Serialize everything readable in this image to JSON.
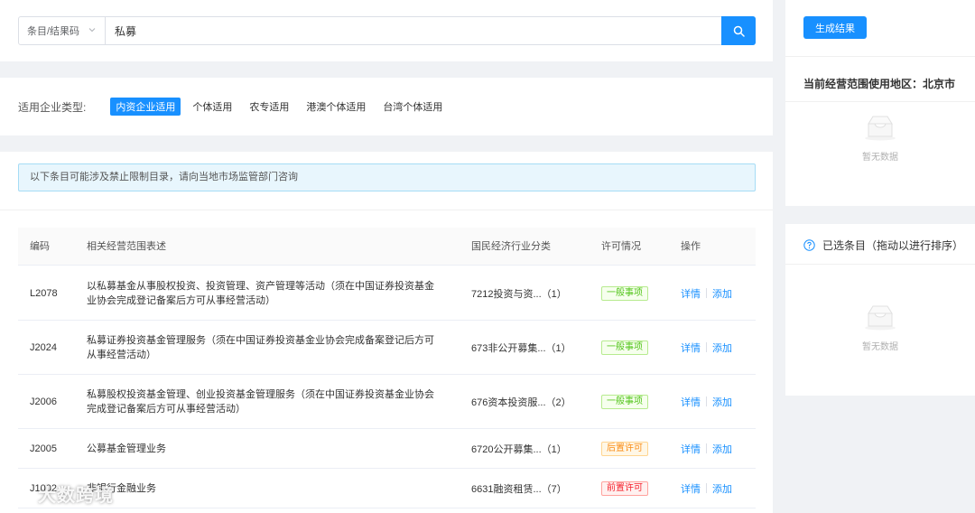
{
  "search": {
    "select_value": "条目/结果码",
    "query": "私募"
  },
  "company_type": {
    "label": "适用企业类型:",
    "options": [
      "内资企业适用",
      "个体适用",
      "农专适用",
      "港澳个体适用",
      "台湾个体适用"
    ],
    "selected": "内资企业适用"
  },
  "results": {
    "notice": "以下条目可能涉及禁止限制目录，请向当地市场监管部门咨询",
    "columns": [
      "编码",
      "相关经营范围表述",
      "国民经济行业分类",
      "许可情况",
      "操作"
    ],
    "rows": [
      {
        "code": "L2078",
        "desc": "以私募基金从事股权投资、投资管理、资产管理等活动（须在中国证券投资基金业协会完成登记备案后方可从事经营活动）",
        "industry": "7212投资与资...（1）",
        "license": "一般事项",
        "license_color": "green",
        "detail": "详情",
        "add": "添加"
      },
      {
        "code": "J2024",
        "desc": "私募证券投资基金管理服务（须在中国证券投资基金业协会完成备案登记后方可从事经营活动）",
        "industry": "673非公开募集...（1）",
        "license": "一般事项",
        "license_color": "green",
        "detail": "详情",
        "add": "添加"
      },
      {
        "code": "J2006",
        "desc": "私募股权投资基金管理、创业投资基金管理服务（须在中国证券投资基金业协会完成登记备案后方可从事经营活动）",
        "industry": "676资本投资服...（2）",
        "license": "一般事项",
        "license_color": "green",
        "detail": "详情",
        "add": "添加"
      },
      {
        "code": "J2005",
        "desc": "公募基金管理业务",
        "industry": "6720公开募集...（1）",
        "license": "后置许可",
        "license_color": "orange",
        "detail": "详情",
        "add": "添加"
      },
      {
        "code": "J1002",
        "desc": "非银行金融业务",
        "industry": "6631融资租赁...（7）",
        "license": "前置许可",
        "license_color": "red",
        "detail": "详情",
        "add": "添加"
      }
    ]
  },
  "right_panel": {
    "generate_button": "生成结果",
    "region_label": "当前经营范围使用地区：北京市",
    "empty_text_1": "暂无数据",
    "selected_title": "已选条目（拖动以进行排序）",
    "empty_text_2": "暂无数据"
  },
  "watermark": "大数跨境",
  "colors": {
    "primary": "#1890ff",
    "green": "#52c41a",
    "orange": "#fa8c16",
    "red": "#f5222d"
  }
}
